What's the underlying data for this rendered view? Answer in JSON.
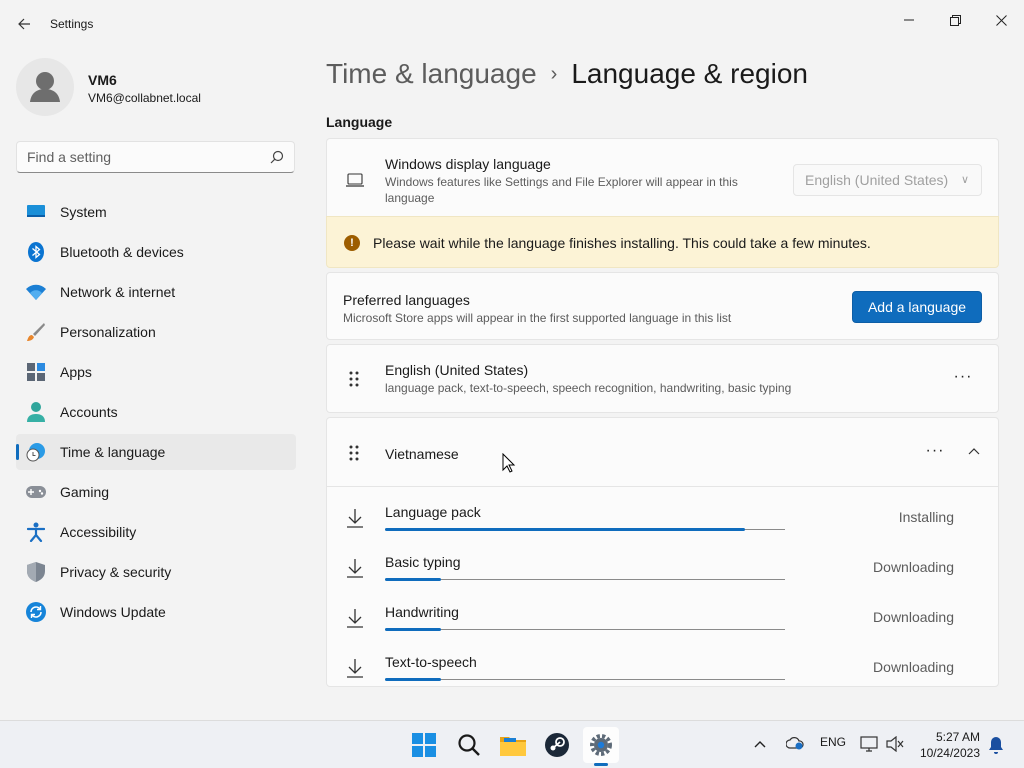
{
  "window": {
    "title": "Settings",
    "back_icon": "back-arrow-icon",
    "minimize_icon": "minimize-icon",
    "maximize_icon": "restore-icon",
    "close_icon": "close-icon"
  },
  "profile": {
    "name": "VM6",
    "email": "VM6@collabnet.local",
    "avatar_icon": "person-avatar-icon"
  },
  "search": {
    "placeholder": "Find a setting",
    "icon": "search-icon"
  },
  "sidebar": {
    "items": [
      {
        "label": "System",
        "icon": "system-icon"
      },
      {
        "label": "Bluetooth & devices",
        "icon": "bluetooth-icon"
      },
      {
        "label": "Network & internet",
        "icon": "wifi-icon"
      },
      {
        "label": "Personalization",
        "icon": "brush-icon"
      },
      {
        "label": "Apps",
        "icon": "apps-icon"
      },
      {
        "label": "Accounts",
        "icon": "accounts-icon"
      },
      {
        "label": "Time & language",
        "icon": "time-language-icon",
        "active": true
      },
      {
        "label": "Gaming",
        "icon": "gamepad-icon"
      },
      {
        "label": "Accessibility",
        "icon": "accessibility-icon"
      },
      {
        "label": "Privacy & security",
        "icon": "shield-icon"
      },
      {
        "label": "Windows Update",
        "icon": "update-icon"
      }
    ]
  },
  "breadcrumb": {
    "parent": "Time & language",
    "separator": "›",
    "current": "Language & region"
  },
  "language_section": {
    "title": "Language",
    "display_language": {
      "title": "Windows display language",
      "description": "Windows features like Settings and File Explorer will appear in this language",
      "selected": "English (United States)",
      "icon": "laptop-icon"
    },
    "warning": {
      "icon": "warning-icon",
      "text": "Please wait while the language finishes installing. This could take a few minutes."
    },
    "preferred": {
      "title": "Preferred languages",
      "description": "Microsoft Store apps will appear in the first supported language in this list",
      "add_button": "Add a language"
    },
    "languages": [
      {
        "name": "English (United States)",
        "features": "language pack, text-to-speech, speech recognition, handwriting, basic typing",
        "more": "···"
      },
      {
        "name": "Vietnamese",
        "more": "···",
        "expanded": true,
        "components": [
          {
            "name": "Language pack",
            "status": "Installing",
            "progress": 0.9
          },
          {
            "name": "Basic typing",
            "status": "Downloading",
            "progress": 0.14
          },
          {
            "name": "Handwriting",
            "status": "Downloading",
            "progress": 0.14
          },
          {
            "name": "Text-to-speech",
            "status": "Downloading",
            "progress": 0.14
          }
        ]
      }
    ]
  },
  "taskbar": {
    "apps": [
      {
        "name": "start",
        "icon": "windows-start-icon"
      },
      {
        "name": "search",
        "icon": "search-icon"
      },
      {
        "name": "file-explorer",
        "icon": "folder-icon"
      },
      {
        "name": "steam",
        "icon": "steam-icon"
      },
      {
        "name": "settings",
        "icon": "gear-icon",
        "active": true
      }
    ],
    "tray": {
      "chevron_icon": "chevron-up-icon",
      "cloud_icon": "onedrive-icon",
      "input_language": "ENG",
      "network_icon": "network-icon",
      "volume_icon": "volume-muted-icon",
      "notification_icon": "bell-icon"
    },
    "clock": {
      "time": "5:27 AM",
      "date": "10/24/2023"
    }
  },
  "colors": {
    "accent": "#0f6cbd",
    "warning_bg": "#fcf3d6",
    "warning_icon": "#9d5d00",
    "window_bg": "#f3f3f3",
    "card_bg": "#fbfbfb"
  }
}
